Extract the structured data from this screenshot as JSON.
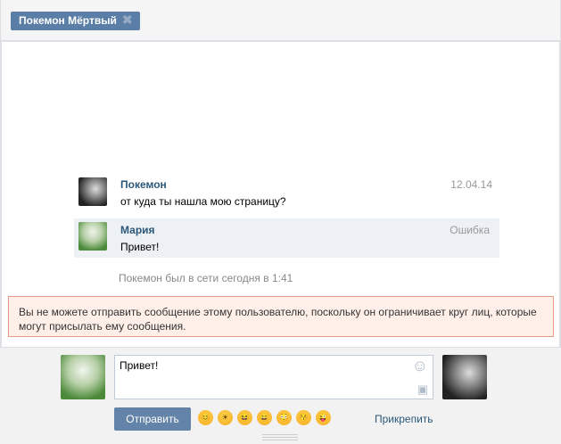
{
  "header": {
    "tab_label": "Покемон Мёртвый"
  },
  "messages": [
    {
      "name": "Покемон",
      "text": "от куда ты нашла мою страницу?",
      "meta": "12.04.14"
    },
    {
      "name": "Мария",
      "text": "Привет!",
      "meta": "Ошибка"
    }
  ],
  "status": "Покемон был в сети сегодня в 1:41",
  "error": "Вы не можете отправить сообщение этому пользователю, поскольку он ограничивает круг лиц, которые могут присылать ему сообщения.",
  "composer": {
    "value": "Привет!",
    "send_label": "Отправить",
    "attach_label": "Прикрепить"
  },
  "emoji": [
    "😊",
    "☀",
    "😆",
    "😄",
    "😳",
    "😚",
    "😜"
  ]
}
